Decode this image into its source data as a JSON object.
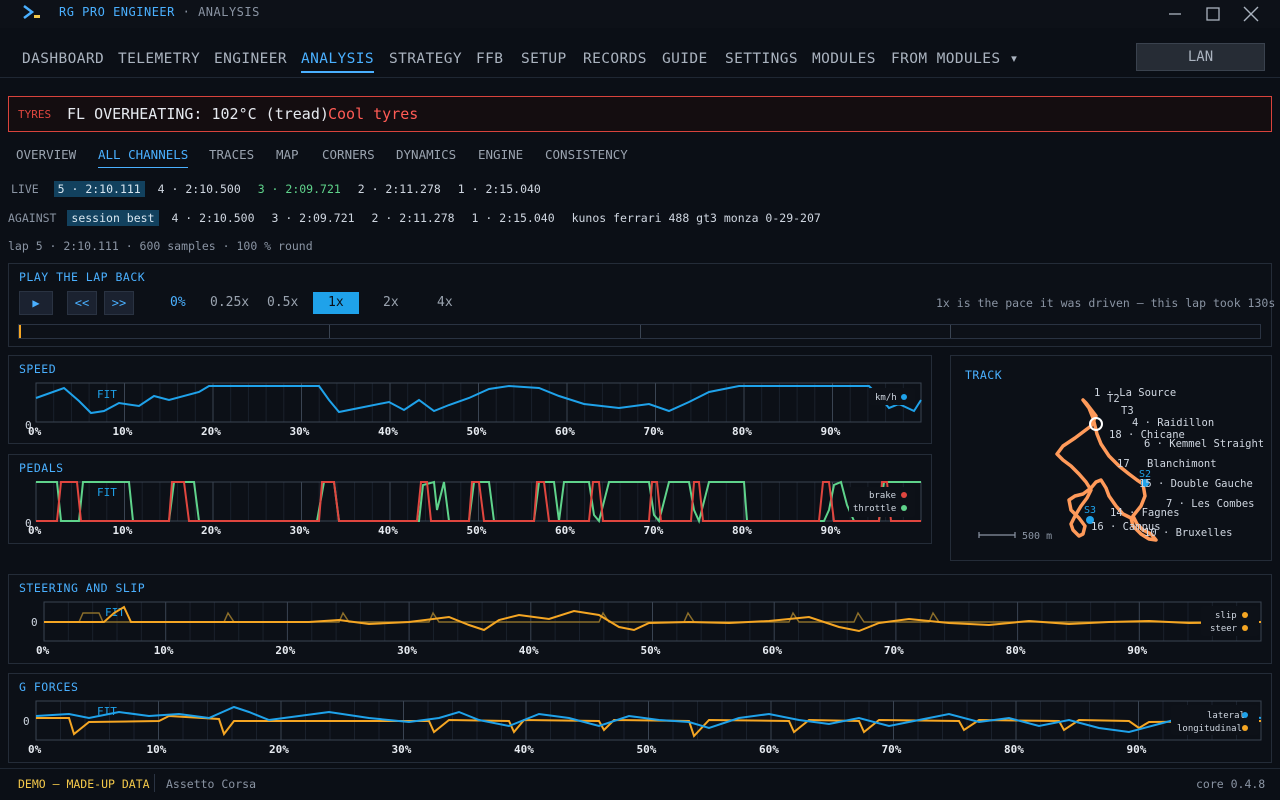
{
  "app": {
    "name": "RG PRO ENGINEER",
    "sep": " · ",
    "page": "ANALYSIS"
  },
  "nav": [
    "DASHBOARD",
    "TELEMETRY",
    "ENGINEER",
    "ANALYSIS",
    "STRATEGY",
    "FFB",
    "SETUP",
    "RECORDS",
    "GUIDE",
    "SETTINGS",
    "MODULES",
    "FROM MODULES ▾"
  ],
  "lan": "LAN",
  "alert": {
    "key": "TYRES",
    "message": "FL OVERHEATING: 102°C (tread)",
    "action": "Cool tyres"
  },
  "subtabs": [
    "OVERVIEW",
    "ALL CHANNELS",
    "TRACES",
    "MAP",
    "CORNERS",
    "DYNAMICS",
    "ENGINE",
    "CONSISTENCY"
  ],
  "live": {
    "label": "LIVE",
    "laps": [
      "5 · 2:10.111",
      "4 · 2:10.500",
      "3 · 2:09.721",
      "2 · 2:11.278",
      "1 · 2:15.040"
    ]
  },
  "against": {
    "label": "AGAINST",
    "laps": [
      "session best",
      "4 · 2:10.500",
      "3 · 2:09.721",
      "2 · 2:11.278",
      "1 · 2:15.040",
      "kunos ferrari 488 gt3 monza 0-29-207"
    ]
  },
  "meta": "lap 5 · 2:10.111 · 600 samples · 100 % round",
  "playback": {
    "title": "PLAY THE LAP BACK",
    "play": "▶",
    "back": "<<",
    "fwd": ">>",
    "progress": "0%",
    "speeds": [
      "0.25x",
      "0.5x",
      "1x",
      "2x",
      "4x"
    ],
    "selected": "1x",
    "hint": "1x is the pace it was driven — this lap took 130s",
    "position": 0
  },
  "charts": {
    "ticks": [
      "0%",
      "10%",
      "20%",
      "30%",
      "40%",
      "50%",
      "60%",
      "70%",
      "80%",
      "90%"
    ],
    "fit": "FIT",
    "speed": {
      "title": "SPEED",
      "legend": "km/h",
      "zero": "0"
    },
    "pedals": {
      "title": "PEDALS",
      "legend": [
        "brake",
        "throttle"
      ],
      "zero": "0"
    },
    "steer": {
      "title": "STEERING AND SLIP",
      "legend": [
        "slip",
        "steer"
      ],
      "zero": "0"
    },
    "g": {
      "title": "G FORCES",
      "legend": [
        "lateral",
        "longitudinal"
      ],
      "zero": "0"
    }
  },
  "track": {
    "title": "TRACK",
    "scale": "500 m",
    "labels": [
      "1 · La Source",
      "T2",
      "T3",
      "4 · Raidillon",
      "18 · Chicane",
      "6 · Kemmel Straight",
      "17",
      "Blanchimont",
      "S2",
      "15 · Double Gauche",
      "7 · Les Combes",
      "S3",
      "14 · Fagnes",
      "16 · Campus",
      "10 · Bruxelles"
    ]
  },
  "colors": {
    "accent": "#4ab0ff",
    "brake": "#e0463f",
    "throttle": "#5fd38b",
    "steer": "#f5a623",
    "lateral": "#1fa2ea",
    "alert": "#d8433c",
    "demo": "#f3c84a"
  },
  "status": {
    "demo": "DEMO — MADE-UP DATA",
    "sim": "Assetto Corsa",
    "version": "core 0.4.8"
  }
}
